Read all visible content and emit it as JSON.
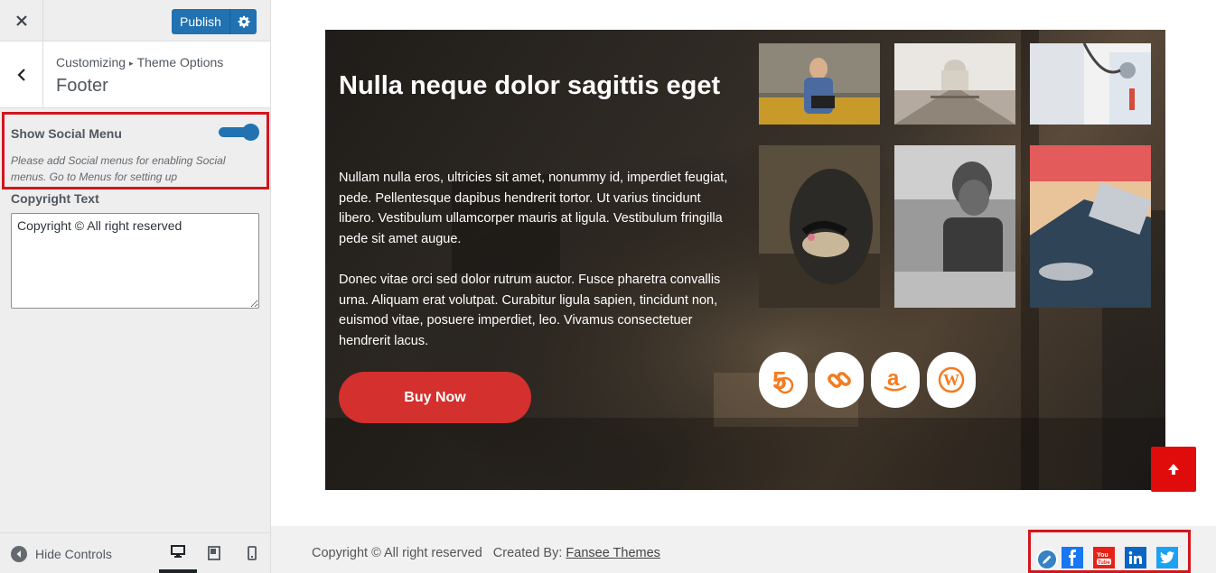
{
  "customizer": {
    "close_icon": "close-icon",
    "publish_label": "Publish",
    "breadcrumb": {
      "root": "Customizing",
      "parent": "Theme Options"
    },
    "section_title": "Footer",
    "show_social_menu": {
      "label": "Show Social Menu",
      "enabled": true,
      "description": "Please add Social menus for enabling Social menus. Go to Menus for setting up"
    },
    "copyright": {
      "label": "Copyright Text",
      "value": "Copyright © All right reserved"
    },
    "footer": {
      "hide_controls_label": "Hide Controls",
      "devices": [
        "desktop",
        "tablet",
        "mobile"
      ],
      "active_device": "desktop"
    }
  },
  "preview": {
    "hero": {
      "title": "Nulla neque dolor sagittis eget",
      "paragraph_1": "Nullam nulla eros, ultricies sit amet, nonummy id, imperdiet feugiat, pede. Pellentesque dapibus hendrerit tortor. Ut varius tincidunt libero. Vestibulum ullamcorper mauris at ligula. Vestibulum fringilla pede sit amet augue.",
      "paragraph_2": "Donec vitae orci sed dolor rutrum auctor. Fusce pharetra convallis urna. Aliquam erat volutpat. Curabitur ligula sapien, tincidunt non, euismod vitae, posuere imperdiet, leo. Vivamus consectetuer hendrerit lacus.",
      "button_label": "Buy Now",
      "gallery": [
        "man-with-laptop",
        "bridge-cathedral",
        "doctor-stethoscope",
        "snake",
        "old-man",
        "person-typing-laptop"
      ],
      "icons": [
        "500px-icon",
        "link-icon",
        "amazon-icon",
        "wordpress-icon"
      ]
    },
    "footer": {
      "copyright": "Copyright © All right reserved",
      "created_by_label": "Created By:",
      "created_by_link": "Fansee Themes",
      "social_icons": [
        "facebook-icon",
        "youtube-icon",
        "linkedin-icon",
        "twitter-icon"
      ]
    }
  },
  "colors": {
    "accent_blue": "#2271b1",
    "highlight_red": "#d3151d",
    "buy_button": "#d3302e",
    "icon_orange": "#f47b20",
    "facebook": "#1877f2",
    "youtube": "#e62117",
    "linkedin": "#0a66c2",
    "twitter": "#1da1f2"
  }
}
